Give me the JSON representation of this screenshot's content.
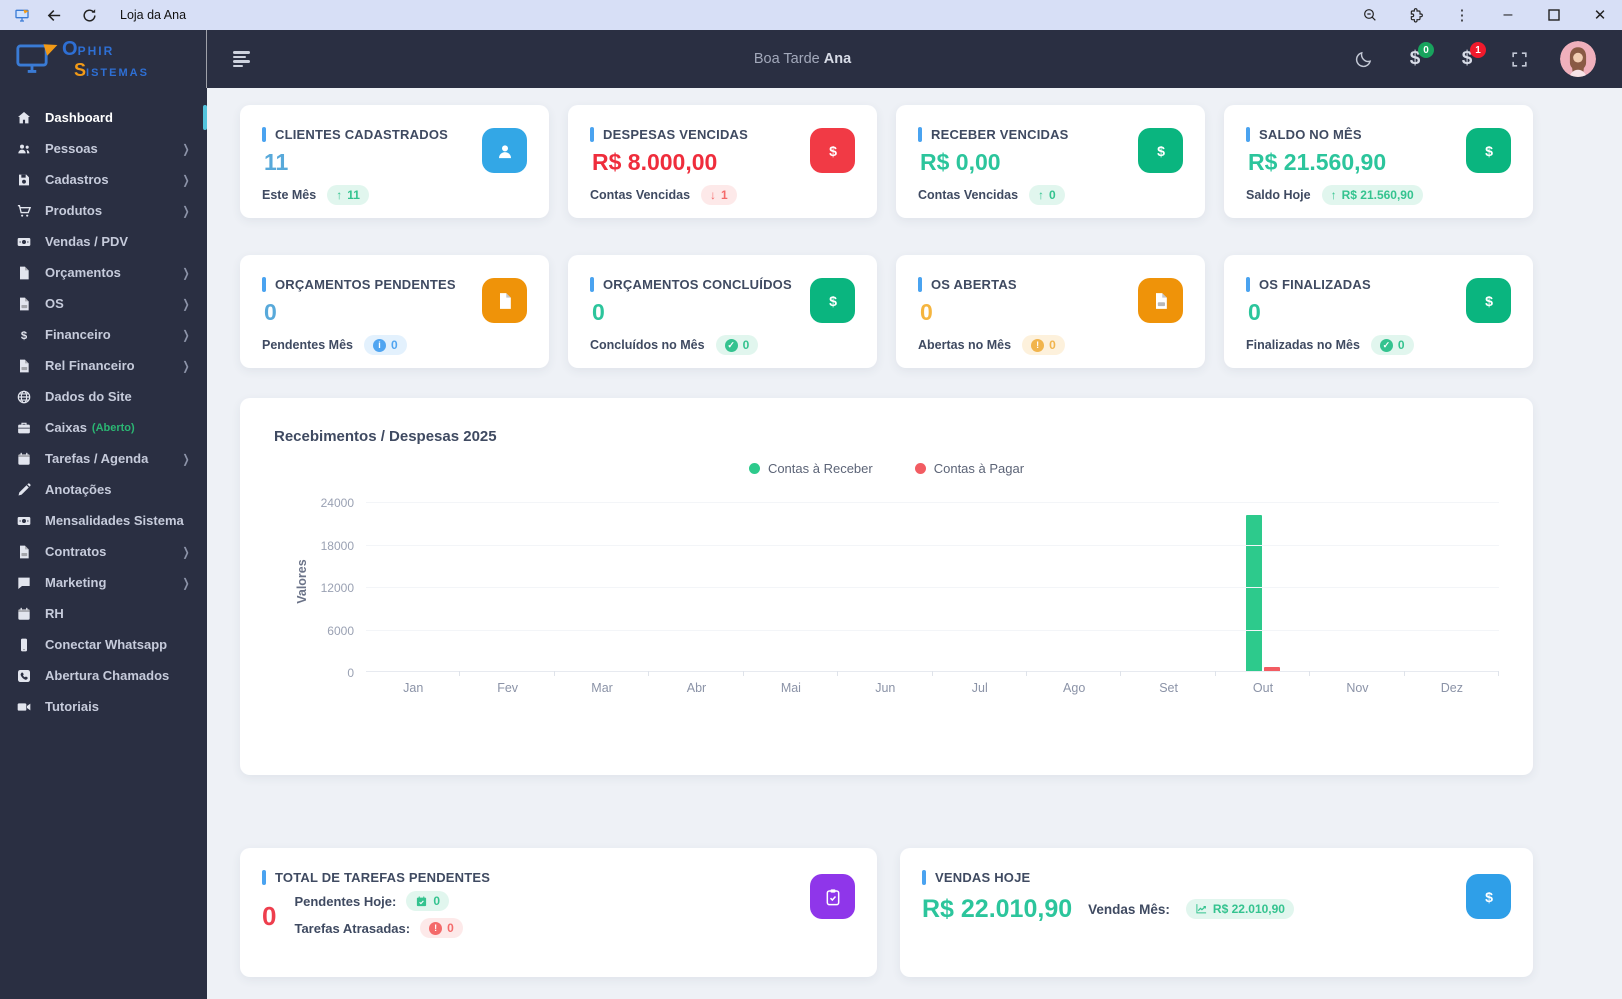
{
  "browser": {
    "tab_title": "Loja da Ana"
  },
  "sidebar": {
    "logo": {
      "word1_initial": "O",
      "word1_rest": "PHIR",
      "word2_initial": "S",
      "word2_rest": "ISTEMAS"
    },
    "items": [
      {
        "label": "Dashboard",
        "icon": "home",
        "active": true
      },
      {
        "label": "Pessoas",
        "icon": "users",
        "chevron": true
      },
      {
        "label": "Cadastros",
        "icon": "save",
        "chevron": true
      },
      {
        "label": "Produtos",
        "icon": "cart",
        "chevron": true
      },
      {
        "label": "Vendas / PDV",
        "icon": "money"
      },
      {
        "label": "Orçamentos",
        "icon": "file",
        "chevron": true
      },
      {
        "label": "OS",
        "icon": "file-pdf",
        "chevron": true
      },
      {
        "label": "Financeiro",
        "icon": "dollar",
        "chevron": true
      },
      {
        "label": "Rel Financeiro",
        "icon": "file-pdf",
        "chevron": true
      },
      {
        "label": "Dados do Site",
        "icon": "globe"
      },
      {
        "label": "Caixas",
        "suffix": "(Aberto)",
        "icon": "briefcase"
      },
      {
        "label": "Tarefas / Agenda",
        "icon": "calendar",
        "chevron": true
      },
      {
        "label": "Anotações",
        "icon": "pen"
      },
      {
        "label": "Mensalidades Sistema",
        "icon": "money"
      },
      {
        "label": "Contratos",
        "icon": "file-pdf",
        "chevron": true
      },
      {
        "label": "Marketing",
        "icon": "chat",
        "chevron": true
      },
      {
        "label": "RH",
        "icon": "calendar"
      },
      {
        "label": "Conectar Whatsapp",
        "icon": "mobile"
      },
      {
        "label": "Abertura Chamados",
        "icon": "phone"
      },
      {
        "label": "Tutoriais",
        "icon": "video"
      }
    ]
  },
  "header": {
    "greeting": "Boa Tarde",
    "user_name": "Ana",
    "badges": [
      {
        "icon": "dollar",
        "count": "0",
        "color": "#18a35d"
      },
      {
        "icon": "dollar",
        "count": "1",
        "color": "#f11a2c"
      }
    ]
  },
  "stat_cards": {
    "row1": [
      {
        "title": "CLIENTES CADASTRADOS",
        "value": "11",
        "value_color": "#58a9da",
        "footer": "Este Mês",
        "pill": {
          "icon": "arrow-up",
          "text": "11",
          "type": "green"
        },
        "tile": {
          "icon": "person",
          "color": "#33a7e6"
        }
      },
      {
        "title": "DESPESAS VENCIDAS",
        "value": "R$ 8.000,00",
        "value_color": "#ef2d3c",
        "footer": "Contas Vencidas",
        "pill": {
          "icon": "arrow-down",
          "text": "1",
          "type": "red"
        },
        "tile": {
          "icon": "dollar",
          "color": "#f13a45"
        }
      },
      {
        "title": "RECEBER VENCIDAS",
        "value": "R$ 0,00",
        "value_color": "#2cc59c",
        "footer": "Contas Vencidas",
        "pill": {
          "icon": "arrow-up",
          "text": "0",
          "type": "green"
        },
        "tile": {
          "icon": "dollar",
          "color": "#0ab57f"
        }
      },
      {
        "title": "SALDO NO MÊS",
        "value": "R$ 21.560,90",
        "value_color": "#2cc59c",
        "footer": "Saldo Hoje",
        "pill": {
          "icon": "arrow-up",
          "text": "R$ 21.560,90",
          "type": "green"
        },
        "tile": {
          "icon": "dollar",
          "color": "#0ab57f"
        }
      }
    ],
    "row2": [
      {
        "title": "ORÇAMENTOS PENDENTES",
        "value": "0",
        "value_color": "#58a9da",
        "footer": "Pendentes Mês",
        "pill": {
          "icon": "info",
          "text": "0",
          "type": "blue"
        },
        "tile": {
          "icon": "file",
          "color": "#ef9309"
        }
      },
      {
        "title": "ORÇAMENTOS CONCLUÍDOS",
        "value": "0",
        "value_color": "#2cc59c",
        "footer": "Concluídos no Mês",
        "pill": {
          "icon": "check",
          "text": "0",
          "type": "green"
        },
        "tile": {
          "icon": "dollar",
          "color": "#0ab57f"
        }
      },
      {
        "title": "OS ABERTAS",
        "value": "0",
        "value_color": "#f5b53f",
        "footer": "Abertas no Mês",
        "pill": {
          "icon": "alert",
          "text": "0",
          "type": "orange"
        },
        "tile": {
          "icon": "file-pdf",
          "color": "#ef9309"
        }
      },
      {
        "title": "OS FINALIZADAS",
        "value": "0",
        "value_color": "#2cc59c",
        "footer": "Finalizadas no Mês",
        "pill": {
          "icon": "check",
          "text": "0",
          "type": "green"
        },
        "tile": {
          "icon": "dollar",
          "color": "#0ab57f"
        }
      }
    ]
  },
  "chart_data": {
    "type": "bar",
    "title": "Recebimentos / Despesas 2025",
    "ylabel": "Valores",
    "xlabel": "",
    "ylim": [
      0,
      24000
    ],
    "yticks": [
      0,
      6000,
      12000,
      18000,
      24000
    ],
    "grid": true,
    "legend_position": "top-center",
    "categories": [
      "Jan",
      "Fev",
      "Mar",
      "Abr",
      "Mai",
      "Jun",
      "Jul",
      "Ago",
      "Set",
      "Out",
      "Nov",
      "Dez"
    ],
    "series": [
      {
        "name": "Contas à Receber",
        "color": "#2dca8c",
        "values": [
          0,
          0,
          0,
          0,
          0,
          0,
          0,
          0,
          0,
          22010.9,
          0,
          0
        ]
      },
      {
        "name": "Contas à Pagar",
        "color": "#f25c62",
        "values": [
          0,
          0,
          0,
          0,
          0,
          0,
          0,
          0,
          0,
          550,
          0,
          0
        ]
      }
    ]
  },
  "bottom_cards": {
    "tasks": {
      "title": "TOTAL DE TAREFAS PENDENTES",
      "value": "0",
      "rows": [
        {
          "label": "Pendentes Hoje:",
          "pill": {
            "icon": "calendar-check",
            "text": "0",
            "type": "green"
          }
        },
        {
          "label": "Tarefas Atrasadas:",
          "pill": {
            "icon": "alert",
            "text": "0",
            "type": "red"
          }
        }
      ],
      "tile": {
        "icon": "clipboard",
        "color": "#8f36ea"
      }
    },
    "sales": {
      "title": "VENDAS HOJE",
      "value": "R$ 22.010,90",
      "month_label": "Vendas Mês:",
      "pill": {
        "icon": "chart-line",
        "text": "R$ 22.010,90",
        "type": "green"
      },
      "tile": {
        "icon": "dollar",
        "color": "#2f9fe8"
      }
    }
  },
  "colors": {
    "sidebar_bg": "#2a2f42",
    "content_bg": "#eef1f6",
    "accent_title_bar": "#4aa3f0",
    "active_indicator": "#53c4dd",
    "green": "#34c38f",
    "red": "#f46a6a",
    "blue": "#50a5f1",
    "orange": "#f1b44c"
  }
}
